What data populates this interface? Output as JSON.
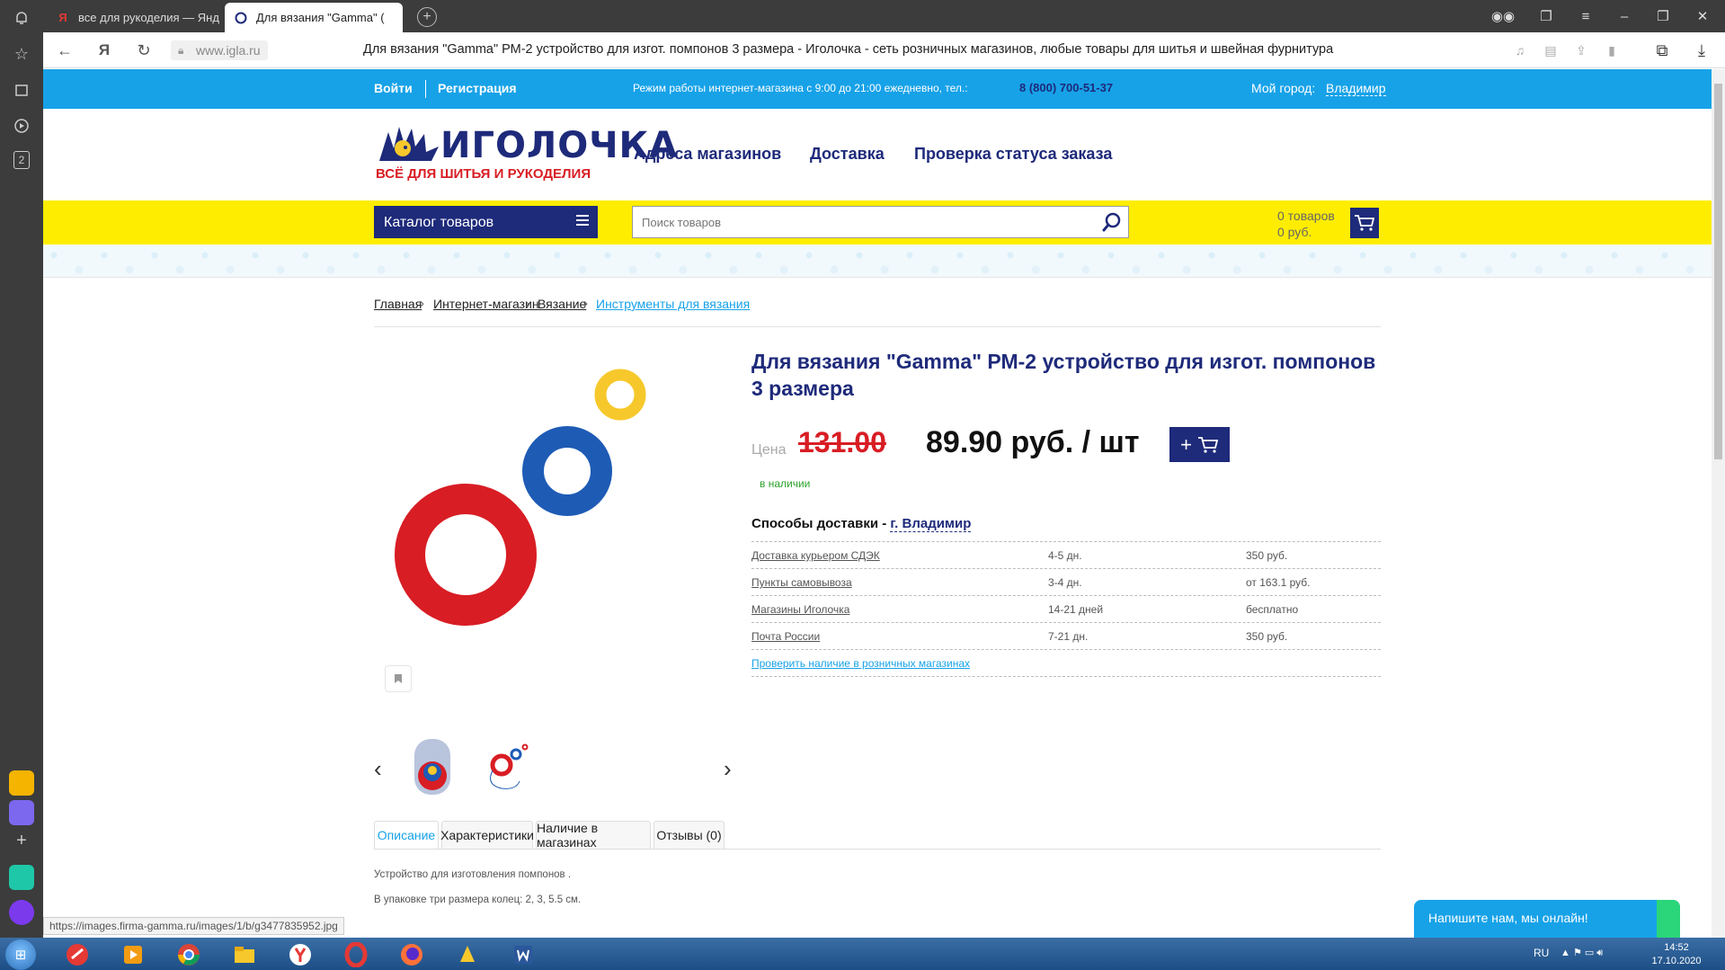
{
  "browser": {
    "tabs": [
      {
        "label": "все для рукоделия — Янд",
        "favicon": "Я"
      },
      {
        "label": "Для вязания \"Gamma\" (",
        "favicon": "igla-favicon"
      }
    ],
    "url": "www.igla.ru",
    "page_title": "Для вязания \"Gamma\" РМ-2 устройство для изгот. помпонов 3 размера - Иголочка - сеть розничных магазинов, любые товары для шитья и швейная фурнитура",
    "rail_badge": "2",
    "status_url": "https://images.firma-gamma.ru/images/1/b/g3477835952.jpg"
  },
  "topbar": {
    "login": "Войти",
    "register": "Регистрация",
    "hours": "Режим работы интернет-магазина с 9:00 до 21:00 ежедневно, тел.:",
    "phone": "8 (800) 700-51-37",
    "city_label": "Мой город:",
    "city": "Владимир",
    "color": "#17a2e8"
  },
  "header": {
    "logo_name": "ИГОЛОЧКА",
    "logo_reg": "®",
    "logo_slogan": "ВСЁ ДЛЯ ШИТЬЯ И РУКОДЕЛИЯ",
    "nav": [
      "Адреса магазинов",
      "Доставка",
      "Проверка статуса заказа"
    ]
  },
  "searchbar": {
    "catalog_label": "Каталог товаров",
    "search_placeholder": "Поиск товаров",
    "cart_count": "0 товаров",
    "cart_sum": "0 руб.",
    "yellow": "#ffed00",
    "navy": "#1e2a7a"
  },
  "breadcrumbs": [
    "Главная",
    "Интернет-магазин",
    "Вязание",
    "Инструменты для вязания"
  ],
  "product": {
    "title": "Для вязания \"Gamma\" РМ-2 устройство для изгот. помпонов 3 размера",
    "price_label": "Цена",
    "old_price": "131.00",
    "price": "89.90 руб. / шт",
    "add_icon": "+",
    "stock": "в наличии",
    "delivery_title": "Способы доставки -",
    "delivery_city": "г. Владимир",
    "delivery": [
      {
        "method": "Доставка курьером СДЭК",
        "time": "4-5 дн.",
        "price": "350 руб."
      },
      {
        "method": "Пункты самовывоза",
        "time": "3-4 дн.",
        "price": "от 163.1 руб."
      },
      {
        "method": "Магазины Иголочка",
        "time": "14-21 дней",
        "price": "бесплатно"
      },
      {
        "method": "Почта России",
        "time": "7-21 дн.",
        "price": "350 руб."
      }
    ],
    "check_stores": "Проверить наличие в розничных магазинах",
    "tabs": [
      "Описание",
      "Характеристики",
      "Наличие в магазинах",
      "Отзывы (0)"
    ],
    "description": [
      "Устройство для изготовления помпонов .",
      "В упаковке три размера колец: 2, 3, 5.5 см."
    ],
    "ring_colors": [
      "#d81d24",
      "#1e5bb5",
      "#f6c82b"
    ]
  },
  "chat": {
    "label": "Напишите нам, мы онлайн!"
  },
  "taskbar": {
    "lang": "RU",
    "time": "14:52",
    "date": "17.10.2020"
  }
}
